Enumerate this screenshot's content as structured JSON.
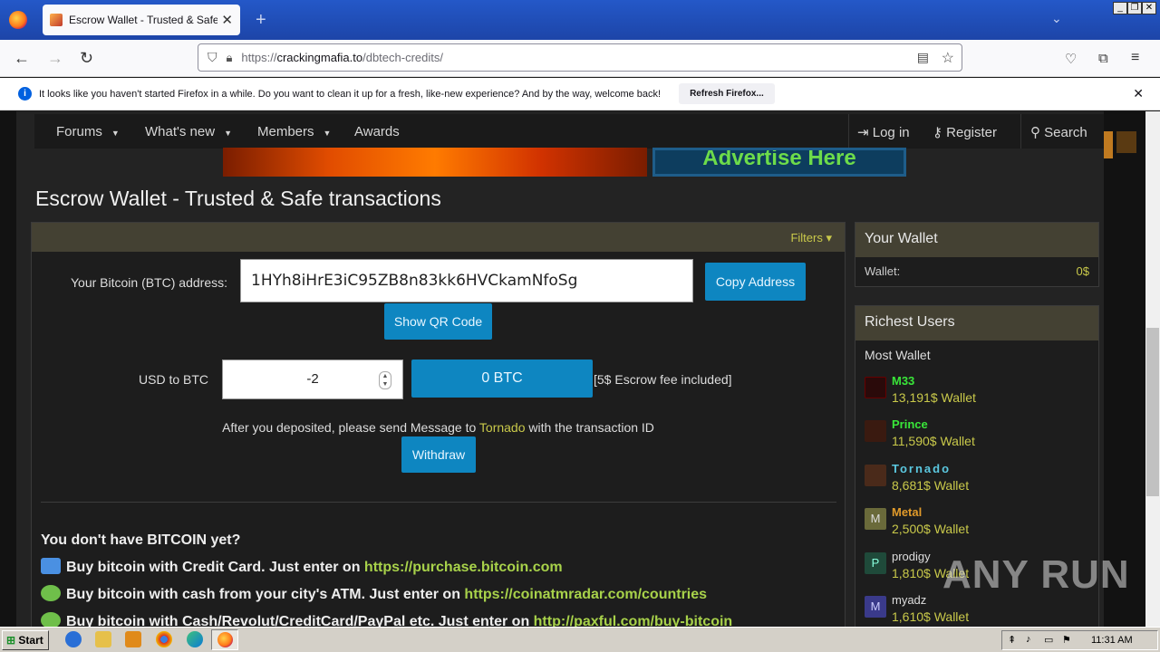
{
  "browser": {
    "tab_title": "Escrow Wallet - Trusted & Safe tra",
    "url_prefix": "https://",
    "url_domain": "crackingmafia.to",
    "url_path": "/dbtech-credits/",
    "notification": "It looks like you haven't started Firefox in a while. Do you want to clean it up for a fresh, like-new experience? And by the way, welcome back!",
    "refresh_button": "Refresh Firefox..."
  },
  "nav": {
    "forums": "Forums",
    "whats_new": "What's new",
    "members": "Members",
    "awards": "Awards",
    "login": "Log in",
    "register": "Register",
    "search": "Search"
  },
  "banner": {
    "advertise": "Advertise Here"
  },
  "page_title": "Escrow Wallet - Trusted & Safe transactions",
  "main": {
    "filters": "Filters ▾",
    "address_label": "Your Bitcoin (BTC) address:",
    "address_value": "1HYh8iHrE3iC95ZB8n83kk6HVCkamNfoSg",
    "copy_address": "Copy Address",
    "show_qr": "Show QR Code",
    "usd_label": "USD to BTC",
    "usd_value": "-2",
    "btc_result": "0 BTC",
    "fee_note": "[5$ Escrow fee included]",
    "deposit_pre": "After you deposited, please send Message to ",
    "deposit_user": "Tornado",
    "deposit_post": " with the transaction ID",
    "withdraw": "Withdraw",
    "no_bitcoin_title": "You don't have BITCOIN yet?",
    "buy_lines": [
      {
        "text": "Buy bitcoin with Credit Card. Just enter on ",
        "link": "https://purchase.bitcoin.com"
      },
      {
        "text": "Buy bitcoin with cash from your city's ATM. Just enter on ",
        "link": "https://coinatmradar.com/countries"
      },
      {
        "text": "Buy bitcoin with Cash/Revolut/CreditCard/PayPal etc. Just enter on ",
        "link": "http://paxful.com/buy-bitcoin"
      }
    ]
  },
  "sidebar": {
    "wallet_title": "Your Wallet",
    "wallet_label": "Wallet:",
    "wallet_value": "0$",
    "richest_title": "Richest Users",
    "most_wallet": "Most Wallet",
    "users": [
      {
        "name": "M33",
        "wallet": "13,191$ Wallet",
        "color": "#39e639"
      },
      {
        "name": "Prince",
        "wallet": "11,590$ Wallet",
        "color": "#39e639"
      },
      {
        "name": "Tornado",
        "wallet": "8,681$ Wallet",
        "color": "#5bc8e0"
      },
      {
        "name": "Metal",
        "wallet": "2,500$ Wallet",
        "color": "#e09a2a"
      },
      {
        "name": "prodigy",
        "wallet": "1,810$ Wallet",
        "color": "#dddddd"
      },
      {
        "name": "myadz",
        "wallet": "1,610$ Wallet",
        "color": "#dddddd"
      }
    ],
    "avatar_letters": [
      "M",
      "P",
      "M"
    ]
  },
  "watermark": "ANY RUN",
  "taskbar": {
    "start": "Start",
    "time": "11:31 AM"
  }
}
